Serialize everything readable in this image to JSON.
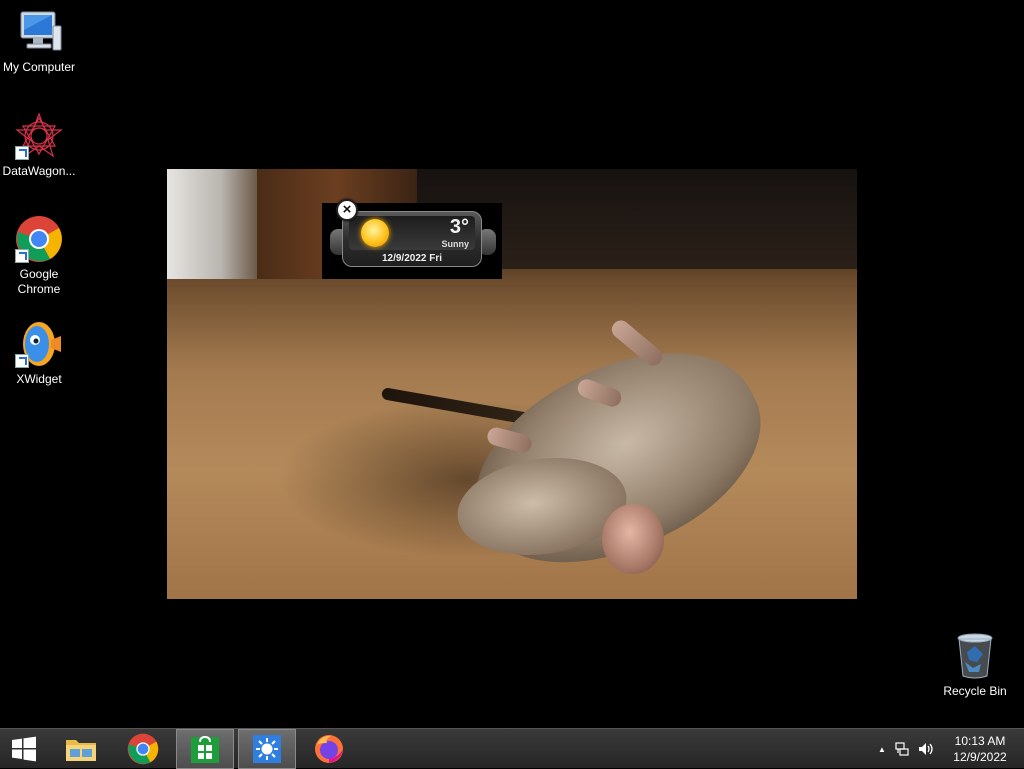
{
  "desktop": {
    "icons": [
      {
        "label": "My Computer",
        "icon": "computer-icon"
      },
      {
        "label": "DataWagon...",
        "icon": "datawagon-icon"
      },
      {
        "label": "Google Chrome",
        "icon": "chrome-icon"
      },
      {
        "label": "XWidget",
        "icon": "xwidget-icon"
      },
      {
        "label": "Recycle Bin",
        "icon": "recycle-bin-icon"
      }
    ]
  },
  "weather_widget": {
    "temperature": "3°",
    "condition": "Sunny",
    "date": "12/9/2022 Fri",
    "close_glyph": "×"
  },
  "taskbar": {
    "items": [
      {
        "name": "start",
        "icon": "windows-start-icon"
      },
      {
        "name": "file-explorer",
        "icon": "folder-icon"
      },
      {
        "name": "chrome",
        "icon": "chrome-icon"
      },
      {
        "name": "store",
        "icon": "store-icon",
        "active": true
      },
      {
        "name": "xwidget-weather",
        "icon": "sun-icon",
        "active": true
      },
      {
        "name": "firefox",
        "icon": "firefox-icon"
      }
    ],
    "tray": {
      "overflow_glyph": "▲",
      "network_icon": "network-icon",
      "volume_icon": "volume-icon"
    },
    "clock": {
      "time": "10:13 AM",
      "date": "12/9/2022"
    }
  },
  "colors": {
    "desktop_bg": "#000000",
    "taskbar_bg": "#2e2e2e",
    "store_green": "#1e9e3a",
    "xwidget_blue": "#2f7fe0"
  }
}
